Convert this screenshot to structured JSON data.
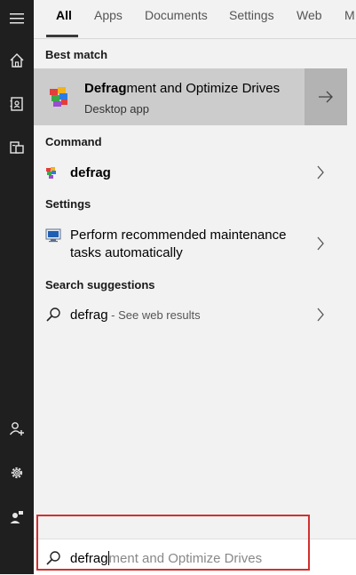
{
  "tabs": [
    {
      "label": "All",
      "active": true
    },
    {
      "label": "Apps"
    },
    {
      "label": "Documents"
    },
    {
      "label": "Settings"
    },
    {
      "label": "Web"
    },
    {
      "label": "M"
    }
  ],
  "sections": {
    "best_match": "Best match",
    "command": "Command",
    "settings": "Settings",
    "suggestions": "Search suggestions"
  },
  "best_match": {
    "title_bold": "Defrag",
    "title_rest": "ment and Optimize Drives",
    "subtitle": "Desktop app",
    "icon": "defrag-app-icon"
  },
  "command": {
    "label": "defrag",
    "icon": "defrag-app-icon"
  },
  "settings_item": {
    "line1": "Perform recommended maintenance",
    "line2": "tasks automatically",
    "icon": "maintenance-settings-icon"
  },
  "suggestion": {
    "term": "defrag",
    "hint": " - See web results"
  },
  "search": {
    "typed": "defrag",
    "autocomplete": "ment and Optimize Drives"
  },
  "colors": {
    "rail": "#1f1f1f",
    "panel": "#f2f2f2",
    "best_bg": "#cccccc",
    "best_arrow_bg": "#b3b3b3",
    "highlight": "#d32f2f"
  }
}
